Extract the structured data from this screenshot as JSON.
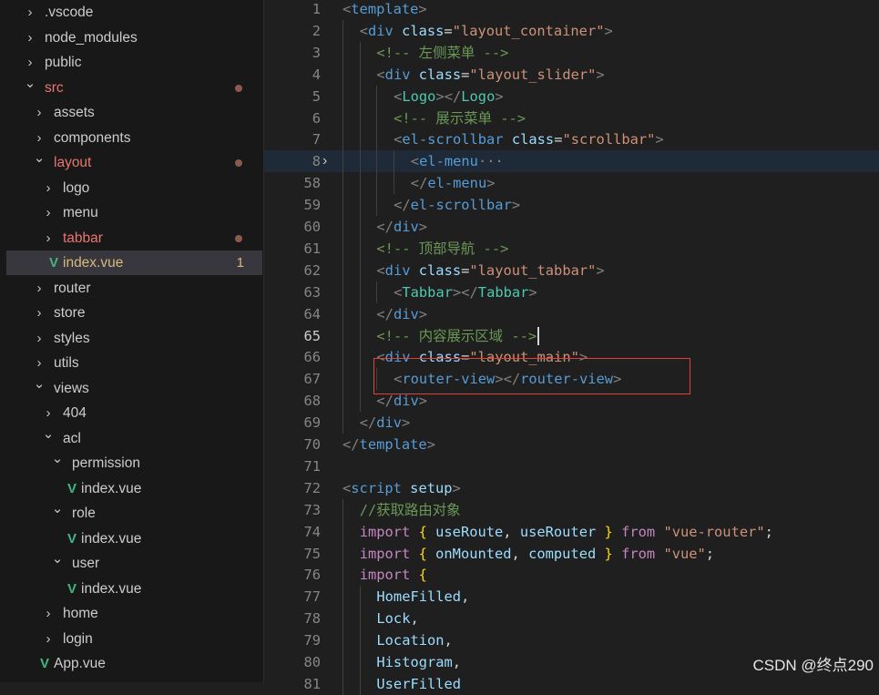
{
  "explorer": {
    "items": [
      {
        "label": ".vscode",
        "indent": 0,
        "type": "folder",
        "expanded": false
      },
      {
        "label": "node_modules",
        "indent": 0,
        "type": "folder",
        "expanded": false
      },
      {
        "label": "public",
        "indent": 0,
        "type": "folder",
        "expanded": false
      },
      {
        "label": "src",
        "indent": 0,
        "type": "folder",
        "expanded": true,
        "status": "modified",
        "dot": true
      },
      {
        "label": "assets",
        "indent": 1,
        "type": "folder",
        "expanded": false
      },
      {
        "label": "components",
        "indent": 1,
        "type": "folder",
        "expanded": false
      },
      {
        "label": "layout",
        "indent": 1,
        "type": "folder",
        "expanded": true,
        "status": "modified",
        "dot": true
      },
      {
        "label": "logo",
        "indent": 2,
        "type": "folder",
        "expanded": false
      },
      {
        "label": "menu",
        "indent": 2,
        "type": "folder",
        "expanded": false
      },
      {
        "label": "tabbar",
        "indent": 2,
        "type": "folder",
        "expanded": false,
        "status": "modified",
        "dot": true
      },
      {
        "label": "index.vue",
        "indent": 2,
        "type": "vue",
        "status": "warn",
        "badge": "1",
        "active": true
      },
      {
        "label": "router",
        "indent": 1,
        "type": "folder",
        "expanded": false
      },
      {
        "label": "store",
        "indent": 1,
        "type": "folder",
        "expanded": false
      },
      {
        "label": "styles",
        "indent": 1,
        "type": "folder",
        "expanded": false
      },
      {
        "label": "utils",
        "indent": 1,
        "type": "folder",
        "expanded": false
      },
      {
        "label": "views",
        "indent": 1,
        "type": "folder",
        "expanded": true
      },
      {
        "label": "404",
        "indent": 2,
        "type": "folder",
        "expanded": false
      },
      {
        "label": "acl",
        "indent": 2,
        "type": "folder",
        "expanded": true
      },
      {
        "label": "permission",
        "indent": 3,
        "type": "folder",
        "expanded": true
      },
      {
        "label": "index.vue",
        "indent": 4,
        "type": "vue"
      },
      {
        "label": "role",
        "indent": 3,
        "type": "folder",
        "expanded": true
      },
      {
        "label": "index.vue",
        "indent": 4,
        "type": "vue"
      },
      {
        "label": "user",
        "indent": 3,
        "type": "folder",
        "expanded": true
      },
      {
        "label": "index.vue",
        "indent": 4,
        "type": "vue"
      },
      {
        "label": "home",
        "indent": 2,
        "type": "folder",
        "expanded": false
      },
      {
        "label": "login",
        "indent": 2,
        "type": "folder",
        "expanded": false
      },
      {
        "label": "App.vue",
        "indent": 1,
        "type": "vue"
      }
    ]
  },
  "editor": {
    "lines": [
      {
        "n": "1",
        "indent": 0,
        "tokens": [
          [
            "punc",
            "<"
          ],
          [
            "tag",
            "template"
          ],
          [
            "punc",
            ">"
          ]
        ]
      },
      {
        "n": "2",
        "indent": 1,
        "tokens": [
          [
            "punc",
            "<"
          ],
          [
            "tag",
            "div"
          ],
          [
            "plain",
            " "
          ],
          [
            "attr",
            "class"
          ],
          [
            "plain",
            "="
          ],
          [
            "str",
            "\"layout_container\""
          ],
          [
            "punc",
            ">"
          ]
        ]
      },
      {
        "n": "3",
        "indent": 2,
        "tokens": [
          [
            "cmt",
            "<!-- 左侧菜单 -->"
          ]
        ]
      },
      {
        "n": "4",
        "indent": 2,
        "tokens": [
          [
            "punc",
            "<"
          ],
          [
            "tag",
            "div"
          ],
          [
            "plain",
            " "
          ],
          [
            "attr",
            "class"
          ],
          [
            "plain",
            "="
          ],
          [
            "str",
            "\"layout_slider\""
          ],
          [
            "punc",
            ">"
          ]
        ]
      },
      {
        "n": "5",
        "indent": 3,
        "tokens": [
          [
            "punc",
            "<"
          ],
          [
            "comp",
            "Logo"
          ],
          [
            "punc",
            "></"
          ],
          [
            "comp",
            "Logo"
          ],
          [
            "punc",
            ">"
          ]
        ]
      },
      {
        "n": "6",
        "indent": 3,
        "tokens": [
          [
            "cmt",
            "<!-- 展示菜单 -->"
          ]
        ]
      },
      {
        "n": "7",
        "indent": 3,
        "tokens": [
          [
            "punc",
            "<"
          ],
          [
            "tag",
            "el-scrollbar"
          ],
          [
            "plain",
            " "
          ],
          [
            "attr",
            "class"
          ],
          [
            "plain",
            "="
          ],
          [
            "str",
            "\"scrollbar\""
          ],
          [
            "punc",
            ">"
          ]
        ]
      },
      {
        "n": "8",
        "indent": 4,
        "fold": "›",
        "highlight": true,
        "tokens": [
          [
            "punc",
            "<"
          ],
          [
            "tag",
            "el-menu"
          ],
          [
            "fold",
            "···"
          ]
        ]
      },
      {
        "n": "58",
        "indent": 4,
        "tokens": [
          [
            "punc",
            "</"
          ],
          [
            "tag",
            "el-menu"
          ],
          [
            "punc",
            ">"
          ]
        ]
      },
      {
        "n": "59",
        "indent": 3,
        "tokens": [
          [
            "punc",
            "</"
          ],
          [
            "tag",
            "el-scrollbar"
          ],
          [
            "punc",
            ">"
          ]
        ]
      },
      {
        "n": "60",
        "indent": 2,
        "tokens": [
          [
            "punc",
            "</"
          ],
          [
            "tag",
            "div"
          ],
          [
            "punc",
            ">"
          ]
        ]
      },
      {
        "n": "61",
        "indent": 2,
        "tokens": [
          [
            "cmt",
            "<!-- 顶部导航 -->"
          ]
        ]
      },
      {
        "n": "62",
        "indent": 2,
        "tokens": [
          [
            "punc",
            "<"
          ],
          [
            "tag",
            "div"
          ],
          [
            "plain",
            " "
          ],
          [
            "attr",
            "class"
          ],
          [
            "plain",
            "="
          ],
          [
            "str",
            "\"layout_tabbar\""
          ],
          [
            "punc",
            ">"
          ]
        ]
      },
      {
        "n": "63",
        "indent": 3,
        "tokens": [
          [
            "punc",
            "<"
          ],
          [
            "comp",
            "Tabbar"
          ],
          [
            "punc",
            "></"
          ],
          [
            "comp",
            "Tabbar"
          ],
          [
            "punc",
            ">"
          ]
        ]
      },
      {
        "n": "64",
        "indent": 2,
        "tokens": [
          [
            "punc",
            "</"
          ],
          [
            "tag",
            "div"
          ],
          [
            "punc",
            ">"
          ]
        ]
      },
      {
        "n": "65",
        "indent": 2,
        "current": true,
        "tokens": [
          [
            "cmt",
            "<!-- 内容展示区域 -->"
          ]
        ]
      },
      {
        "n": "66",
        "indent": 2,
        "tokens": [
          [
            "punc",
            "<"
          ],
          [
            "tag",
            "div"
          ],
          [
            "plain",
            " "
          ],
          [
            "attr",
            "class"
          ],
          [
            "plain",
            "="
          ],
          [
            "str",
            "\"layout_main\""
          ],
          [
            "punc",
            ">"
          ]
        ]
      },
      {
        "n": "67",
        "indent": 3,
        "tokens": [
          [
            "punc",
            "<"
          ],
          [
            "tag",
            "router-view"
          ],
          [
            "punc",
            "></"
          ],
          [
            "tag",
            "router-view"
          ],
          [
            "punc",
            ">"
          ]
        ]
      },
      {
        "n": "68",
        "indent": 2,
        "tokens": [
          [
            "punc",
            "</"
          ],
          [
            "tag",
            "div"
          ],
          [
            "punc",
            ">"
          ]
        ]
      },
      {
        "n": "69",
        "indent": 1,
        "tokens": [
          [
            "punc",
            "</"
          ],
          [
            "tag",
            "div"
          ],
          [
            "punc",
            ">"
          ]
        ]
      },
      {
        "n": "70",
        "indent": 0,
        "tokens": [
          [
            "punc",
            "</"
          ],
          [
            "tag",
            "template"
          ],
          [
            "punc",
            ">"
          ]
        ]
      },
      {
        "n": "71",
        "indent": 0,
        "tokens": []
      },
      {
        "n": "72",
        "indent": 0,
        "tokens": [
          [
            "punc",
            "<"
          ],
          [
            "tag",
            "script"
          ],
          [
            "plain",
            " "
          ],
          [
            "attr",
            "setup"
          ],
          [
            "punc",
            ">"
          ]
        ]
      },
      {
        "n": "73",
        "indent": 1,
        "tokens": [
          [
            "cmt",
            "//获取路由对象"
          ]
        ]
      },
      {
        "n": "74",
        "indent": 1,
        "tokens": [
          [
            "kw",
            "import"
          ],
          [
            "plain",
            " "
          ],
          [
            "curly",
            "{"
          ],
          [
            "plain",
            " "
          ],
          [
            "id",
            "useRoute"
          ],
          [
            "plain",
            ", "
          ],
          [
            "id",
            "useRouter"
          ],
          [
            "plain",
            " "
          ],
          [
            "curly",
            "}"
          ],
          [
            "plain",
            " "
          ],
          [
            "kw",
            "from"
          ],
          [
            "plain",
            " "
          ],
          [
            "str",
            "\"vue-router\""
          ],
          [
            "plain",
            ";"
          ]
        ]
      },
      {
        "n": "75",
        "indent": 1,
        "tokens": [
          [
            "kw",
            "import"
          ],
          [
            "plain",
            " "
          ],
          [
            "curly",
            "{"
          ],
          [
            "plain",
            " "
          ],
          [
            "id",
            "onMounted"
          ],
          [
            "plain",
            ", "
          ],
          [
            "id",
            "computed"
          ],
          [
            "plain",
            " "
          ],
          [
            "curly",
            "}"
          ],
          [
            "plain",
            " "
          ],
          [
            "kw",
            "from"
          ],
          [
            "plain",
            " "
          ],
          [
            "str",
            "\"vue\""
          ],
          [
            "plain",
            ";"
          ]
        ]
      },
      {
        "n": "76",
        "indent": 1,
        "tokens": [
          [
            "kw",
            "import"
          ],
          [
            "plain",
            " "
          ],
          [
            "curly",
            "{"
          ]
        ]
      },
      {
        "n": "77",
        "indent": 2,
        "tokens": [
          [
            "id",
            "HomeFilled"
          ],
          [
            "plain",
            ","
          ]
        ]
      },
      {
        "n": "78",
        "indent": 2,
        "tokens": [
          [
            "id",
            "Lock"
          ],
          [
            "plain",
            ","
          ]
        ]
      },
      {
        "n": "79",
        "indent": 2,
        "tokens": [
          [
            "id",
            "Location"
          ],
          [
            "plain",
            ","
          ]
        ]
      },
      {
        "n": "80",
        "indent": 2,
        "tokens": [
          [
            "id",
            "Histogram"
          ],
          [
            "plain",
            ","
          ]
        ]
      },
      {
        "n": "81",
        "indent": 2,
        "tokens": [
          [
            "id",
            "UserFilled"
          ]
        ]
      }
    ]
  },
  "watermark": "CSDN @终点290",
  "colors": {
    "accent_red_box": "#e0413a",
    "modified": "#e9756f",
    "vue_icon": "#41b883"
  }
}
